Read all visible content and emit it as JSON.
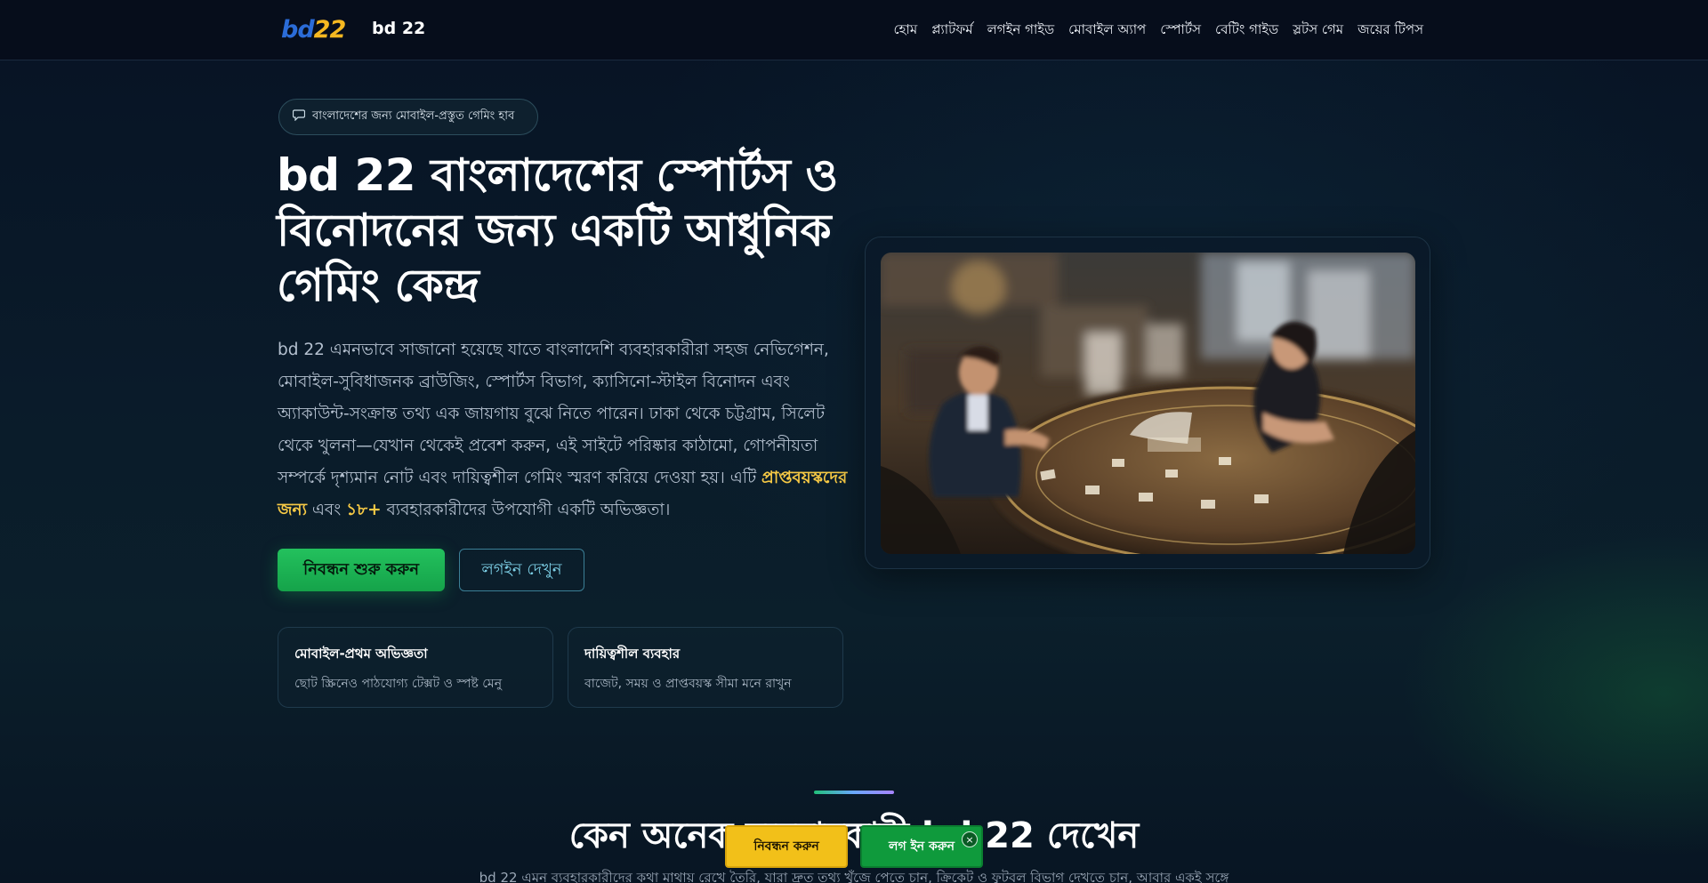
{
  "header": {
    "logo": {
      "bd": "bd",
      "num": "22"
    },
    "brand_name": "bd 22",
    "nav": [
      "হোম",
      "প্ল্যাটফর্ম",
      "লগইন গাইড",
      "মোবাইল অ্যাপ",
      "স্পোর্টস",
      "বেটিং গাইড",
      "স্লটস গেম",
      "জয়ের টিপস"
    ]
  },
  "hero": {
    "badge_icon": "chat-icon",
    "badge": "বাংলাদেশের জন্য মোবাইল-প্রস্তুত গেমিং হাব",
    "title": "bd 22 বাংলাদেশের স্পোর্টস ও বিনোদনের জন্য একটি আধুনিক গেমিং কেন্দ্র",
    "desc_part1": "bd 22 এমনভাবে সাজানো হয়েছে যাতে বাংলাদেশি ব্যবহারকারীরা সহজ নেভিগেশন, মোবাইল-সুবিধাজনক ব্রাউজিং, স্পোর্টস বিভাগ, ক্যাসিনো-স্টাইল বিনোদন এবং অ্যাকাউন্ট-সংক্রান্ত তথ্য এক জায়গায় বুঝে নিতে পারেন। ঢাকা থেকে চট্টগ্রাম, সিলেট থেকে খুলনা—যেখান থেকেই প্রবেশ করুন, এই সাইটে পরিষ্কার কাঠামো, গোপনীয়তা সম্পর্কে দৃশ্যমান নোট এবং দায়িত্বশীল গেমিং স্মরণ করিয়ে দেওয়া হয়। এটি ",
    "desc_hl1": "প্রাপ্তবয়স্কদের জন্য",
    "desc_part2": " এবং ",
    "desc_hl2": "১৮+",
    "desc_part3": " ব্যবহারকারীদের উপযোগী একটি অভিজ্ঞতা।",
    "btn_primary": "নিবন্ধন শুরু করুন",
    "btn_secondary": "লগইন দেখুন",
    "features": [
      {
        "title": "মোবাইল-প্রথম অভিজ্ঞতা",
        "text": "ছোট স্ক্রিনেও পাঠযোগ্য টেক্সট ও স্পষ্ট মেনু"
      },
      {
        "title": "দায়িত্বশীল ব্যবহার",
        "text": "বাজেট, সময় ও প্রাপ্তবয়স্ক সীমা মনে রাখুন"
      }
    ]
  },
  "section": {
    "title": "কেন অনেক ব্যবহারকারী bd 22 দেখেন",
    "subtitle": "bd 22 এমন ব্যবহারকারীদের কথা মাথায় রেখে তৈরি, যারা দ্রুত তথ্য খুঁজে পেতে চান, ক্রিকেট ও ফুটবল বিভাগ দেখতে চান, আবার একই সঙ্গে"
  },
  "sticky": {
    "register": "নিবন্ধন করুন",
    "login": "লগ ইন করুন",
    "close": "×"
  },
  "colors": {
    "accent_green": "#1fb456",
    "accent_yellow": "#f6c945",
    "background": "#071222"
  }
}
